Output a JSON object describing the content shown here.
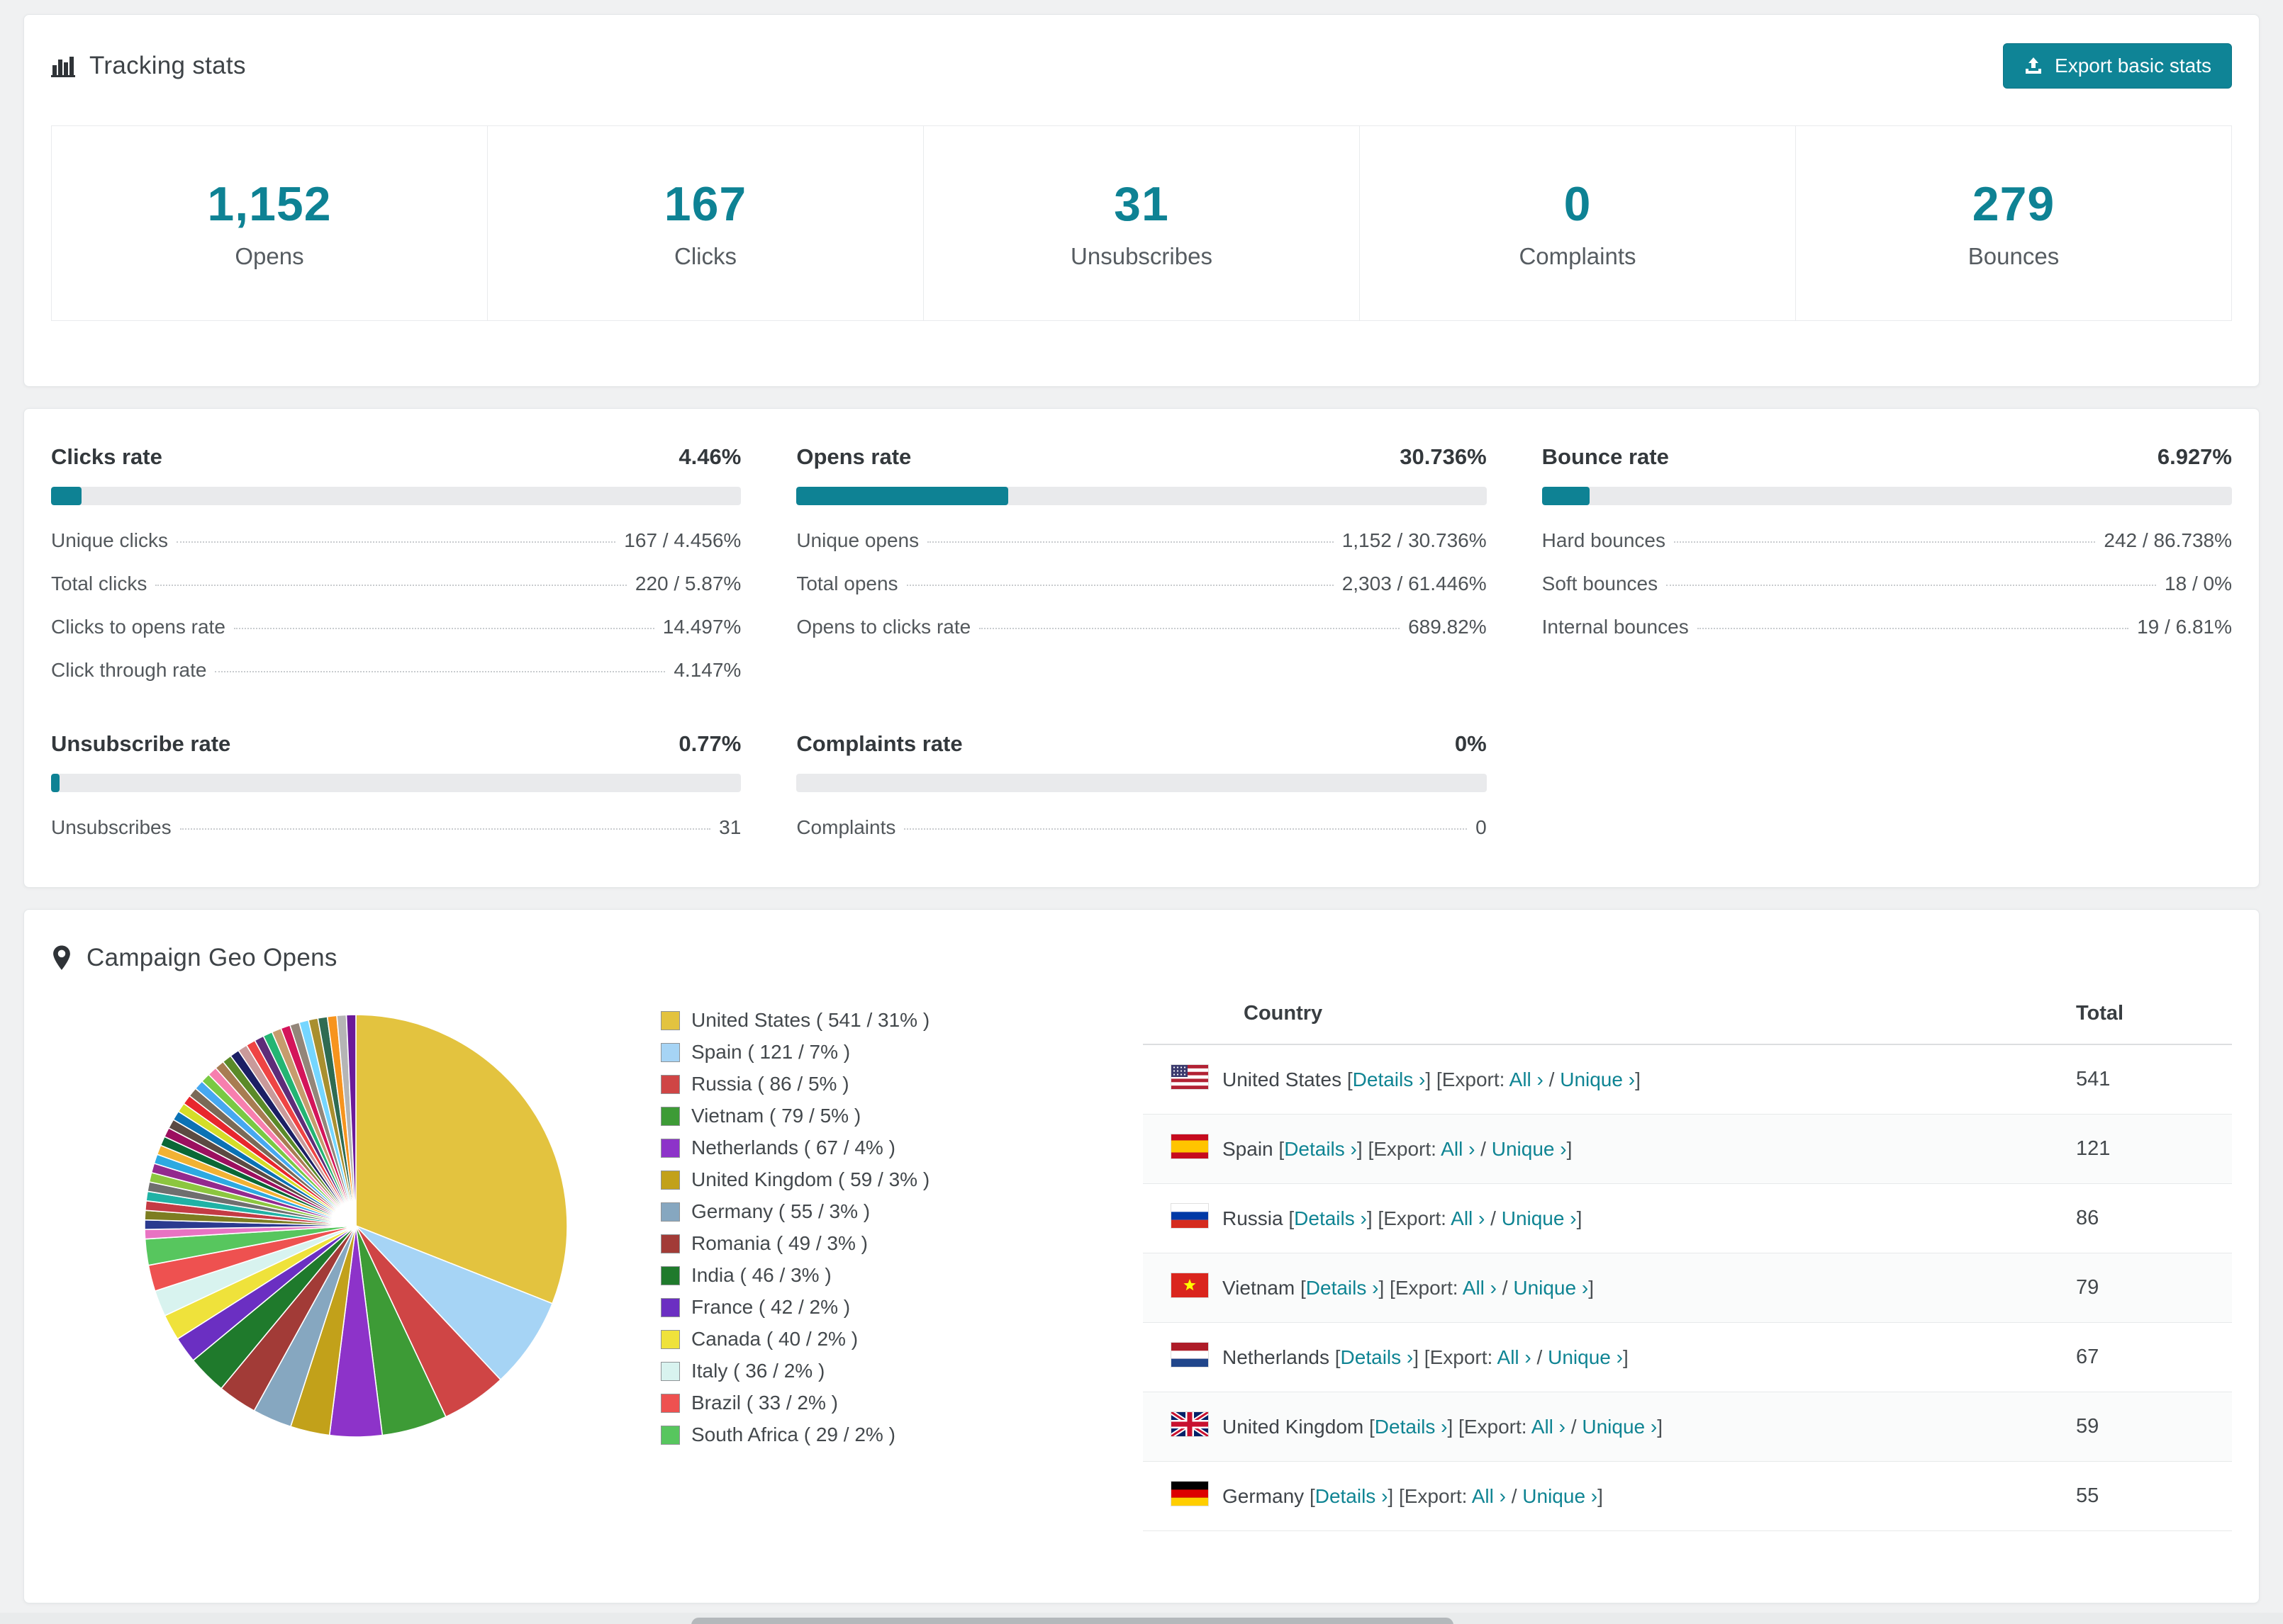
{
  "colors": {
    "accent": "#0e8294",
    "button": "#0f8496",
    "link": "#0f8493"
  },
  "tracking": {
    "title": "Tracking stats",
    "export_label": "Export basic stats",
    "stats": [
      {
        "value": "1,152",
        "label": "Opens"
      },
      {
        "value": "167",
        "label": "Clicks"
      },
      {
        "value": "31",
        "label": "Unsubscribes"
      },
      {
        "value": "0",
        "label": "Complaints"
      },
      {
        "value": "279",
        "label": "Bounces"
      }
    ]
  },
  "rates": [
    {
      "title": "Clicks rate",
      "value": "4.46%",
      "pct": 4.46,
      "rows": [
        {
          "label": "Unique clicks",
          "value": "167 / 4.456%"
        },
        {
          "label": "Total clicks",
          "value": "220 / 5.87%"
        },
        {
          "label": "Clicks to opens rate",
          "value": "14.497%"
        },
        {
          "label": "Click through rate",
          "value": "4.147%"
        }
      ]
    },
    {
      "title": "Opens rate",
      "value": "30.736%",
      "pct": 30.736,
      "rows": [
        {
          "label": "Unique opens",
          "value": "1,152 / 30.736%"
        },
        {
          "label": "Total opens",
          "value": "2,303 / 61.446%"
        },
        {
          "label": "Opens to clicks rate",
          "value": "689.82%"
        }
      ]
    },
    {
      "title": "Bounce rate",
      "value": "6.927%",
      "pct": 6.927,
      "rows": [
        {
          "label": "Hard bounces",
          "value": "242 / 86.738%"
        },
        {
          "label": "Soft bounces",
          "value": "18 / 0%"
        },
        {
          "label": "Internal bounces",
          "value": "19 / 6.81%"
        }
      ]
    },
    {
      "title": "Unsubscribe rate",
      "value": "0.77%",
      "pct": 0.77,
      "rows": [
        {
          "label": "Unsubscribes",
          "value": "31"
        }
      ]
    },
    {
      "title": "Complaints rate",
      "value": "0%",
      "pct": 0,
      "rows": [
        {
          "label": "Complaints",
          "value": "0"
        }
      ]
    }
  ],
  "geo": {
    "title": "Campaign Geo Opens",
    "table": {
      "columns": [
        "Country",
        "Total"
      ],
      "links": {
        "details": "Details ›",
        "export_label": "Export:",
        "all": "All ›",
        "unique": "Unique ›"
      },
      "rows": [
        {
          "flag": "us",
          "country": "United States",
          "total": "541"
        },
        {
          "flag": "es",
          "country": "Spain",
          "total": "121"
        },
        {
          "flag": "ru",
          "country": "Russia",
          "total": "86"
        },
        {
          "flag": "vn",
          "country": "Vietnam",
          "total": "79"
        },
        {
          "flag": "nl",
          "country": "Netherlands",
          "total": "67"
        },
        {
          "flag": "gb",
          "country": "United Kingdom",
          "total": "59"
        },
        {
          "flag": "de",
          "country": "Germany",
          "total": "55"
        }
      ]
    }
  },
  "chart_data": {
    "type": "pie",
    "title": "Campaign Geo Opens",
    "unit": "opens",
    "legend_position": "right",
    "slices": [
      {
        "label": "United States",
        "value": 541,
        "pct": 31,
        "color": "#e3c33f"
      },
      {
        "label": "Spain",
        "value": 121,
        "pct": 7,
        "color": "#a6d4f5"
      },
      {
        "label": "Russia",
        "value": 86,
        "pct": 5,
        "color": "#cf4545"
      },
      {
        "label": "Vietnam",
        "value": 79,
        "pct": 5,
        "color": "#3d9b36"
      },
      {
        "label": "Netherlands",
        "value": 67,
        "pct": 4,
        "color": "#8d33c9"
      },
      {
        "label": "United Kingdom",
        "value": 59,
        "pct": 3,
        "color": "#c2a11a"
      },
      {
        "label": "Germany",
        "value": 55,
        "pct": 3,
        "color": "#86a7c0"
      },
      {
        "label": "Romania",
        "value": 49,
        "pct": 3,
        "color": "#a23b37"
      },
      {
        "label": "India",
        "value": 46,
        "pct": 3,
        "color": "#1f7a2c"
      },
      {
        "label": "France",
        "value": 42,
        "pct": 2,
        "color": "#6b2fc2"
      },
      {
        "label": "Canada",
        "value": 40,
        "pct": 2,
        "color": "#efe23b"
      },
      {
        "label": "Italy",
        "value": 36,
        "pct": 2,
        "color": "#d8f3ef"
      },
      {
        "label": "Brazil",
        "value": 33,
        "pct": 2,
        "color": "#ee5150"
      },
      {
        "label": "South Africa",
        "value": 29,
        "pct": 2,
        "color": "#57c65e"
      }
    ],
    "others_pct": 26,
    "others_segment_count": 36,
    "others_palette": [
      "#e873c2",
      "#2b3a8f",
      "#7d7d21",
      "#c43b44",
      "#20b2a5",
      "#6f6f6f",
      "#8cc63f",
      "#932a8e",
      "#2da9e1",
      "#f2b233",
      "#0a6836",
      "#9c0f5f",
      "#5b4a42",
      "#0b72b5",
      "#d5dd28",
      "#e8262d",
      "#7a6a57",
      "#46a8f0",
      "#7ac943",
      "#f77fae",
      "#a87c52",
      "#5a8a28",
      "#1b1f64",
      "#c99a9a",
      "#ef4444",
      "#5e2d79",
      "#23b573",
      "#c69c6d",
      "#d4145a",
      "#93867a",
      "#75d6ff",
      "#a98f2f",
      "#2f6b52",
      "#f7941e",
      "#b5b5b5",
      "#6b1a99"
    ]
  }
}
